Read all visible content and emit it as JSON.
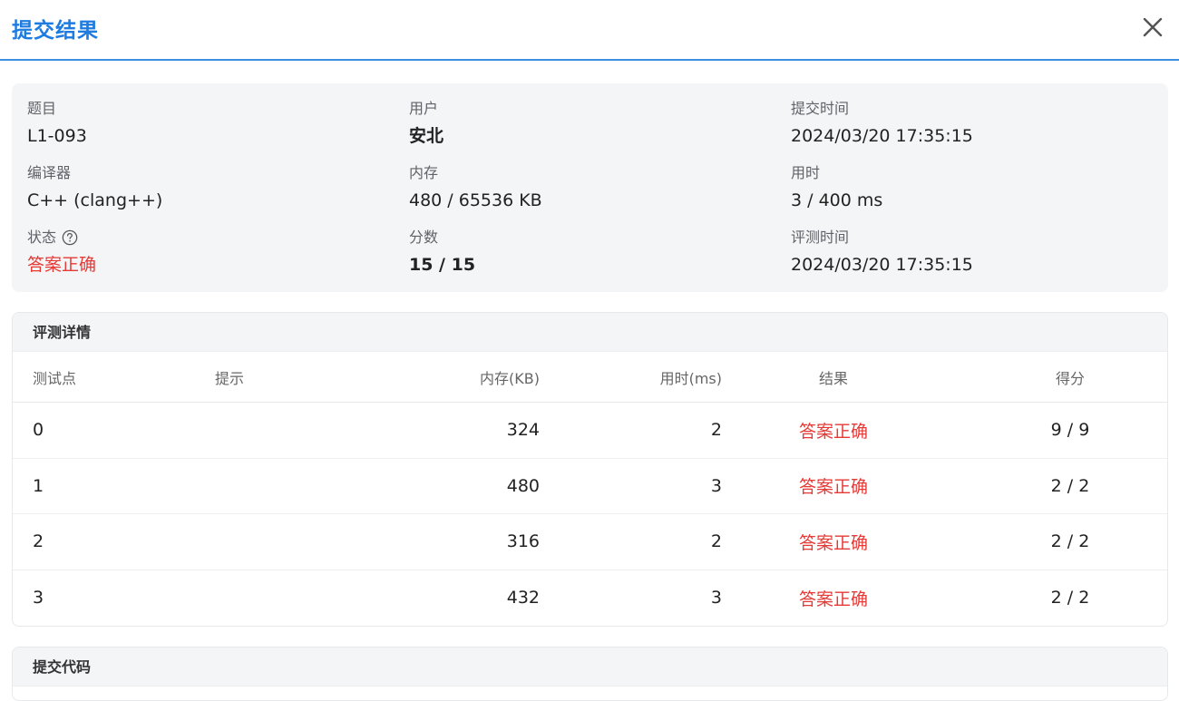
{
  "header": {
    "title": "提交结果",
    "close_icon": "close-icon"
  },
  "info": {
    "problem_label": "题目",
    "problem_value": "L1-093",
    "user_label": "用户",
    "user_value": "安北",
    "submit_time_label": "提交时间",
    "submit_time_value": "2024/03/20 17:35:15",
    "compiler_label": "编译器",
    "compiler_value": "C++ (clang++)",
    "memory_label": "内存",
    "memory_value": "480 / 65536 KB",
    "time_label": "用时",
    "time_value": "3 / 400 ms",
    "status_label": "状态",
    "status_value": "答案正确",
    "score_label": "分数",
    "score_value": "15 / 15",
    "judge_time_label": "评测时间",
    "judge_time_value": "2024/03/20 17:35:15",
    "status_color": "#e53935"
  },
  "details": {
    "title": "评测详情",
    "columns": [
      "测试点",
      "提示",
      "内存(KB)",
      "用时(ms)",
      "结果",
      "得分"
    ],
    "rows": [
      {
        "case": "0",
        "hint": "",
        "memory": "324",
        "time": "2",
        "result": "答案正确",
        "score": "9 / 9"
      },
      {
        "case": "1",
        "hint": "",
        "memory": "480",
        "time": "3",
        "result": "答案正确",
        "score": "2 / 2"
      },
      {
        "case": "2",
        "hint": "",
        "memory": "316",
        "time": "2",
        "result": "答案正确",
        "score": "2 / 2"
      },
      {
        "case": "3",
        "hint": "",
        "memory": "432",
        "time": "3",
        "result": "答案正确",
        "score": "2 / 2"
      }
    ]
  },
  "code": {
    "title": "提交代码"
  },
  "colors": {
    "accent": "#1e7ce0",
    "error_red": "#e53935",
    "panel_bg": "#f4f5f7"
  }
}
